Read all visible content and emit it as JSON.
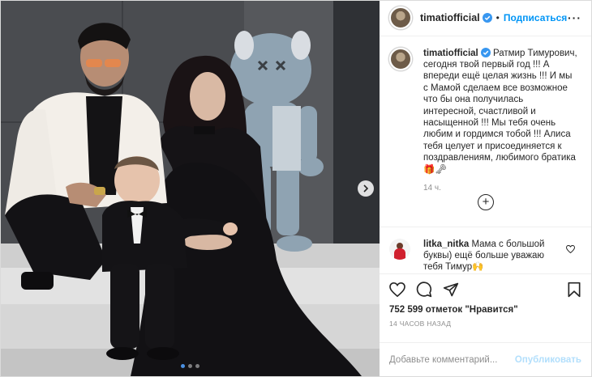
{
  "colors": {
    "accent": "#0095f6",
    "accent_disabled": "#b2dffc",
    "text": "#262626",
    "muted": "#8e8e8e",
    "border": "#dbdbdb"
  },
  "icons": {
    "next": "chevron-right-icon",
    "verified": "verified-badge-icon",
    "more": "more-options-icon",
    "load_more": "plus-circle-icon",
    "like": "heart-icon",
    "comment": "comment-icon",
    "share": "send-icon",
    "save": "bookmark-icon"
  },
  "header": {
    "username": "timatiofficial",
    "separator": "•",
    "follow_label": "Подписаться",
    "more_label": "···"
  },
  "caption": {
    "username": "timatiofficial",
    "text": "Ратмир Тимурович, сегодня твой первый год !!! А впереди ещё целая жизнь !!! И мы с Мамой сделаем все возможное что бы она получилась интересной, счастливой и насыщенной !!! Мы тебя очень любим и гордимся тобой !!! Алиса тебя целует и присоединяется к поздравлениям, любимого братика 🎁🗝",
    "time": "14 ч."
  },
  "load_more_label": "+",
  "comment": {
    "username": "litka_nitka",
    "text": "Мама с большой буквы) ещё больше уважаю тебя Тимур🙌"
  },
  "likes": {
    "count": "752 599",
    "text": " отметок \"Нравится\""
  },
  "post_time": "14 ЧАСОВ НАЗАД",
  "add_comment": {
    "placeholder": "Добавьте комментарий...",
    "publish_label": "Опубликовать"
  },
  "carousel": {
    "total": 3,
    "current": 1
  }
}
